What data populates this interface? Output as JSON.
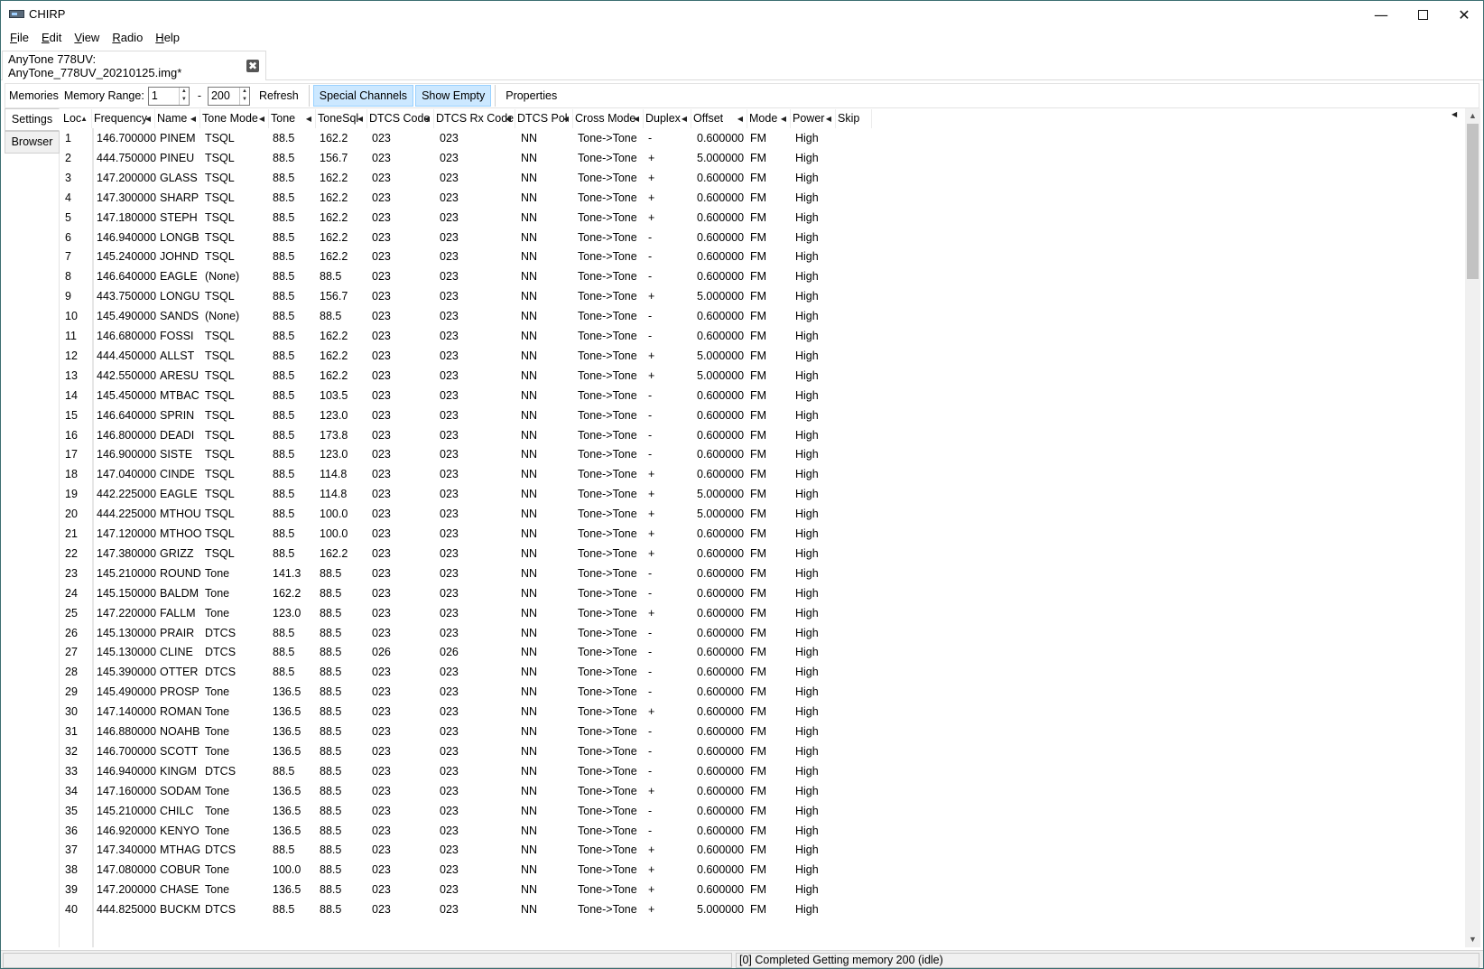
{
  "window": {
    "title": "CHIRP",
    "min_glyph": "—",
    "close_glyph": "✕"
  },
  "menu": [
    {
      "label": "File",
      "key": "F",
      "rest": "ile"
    },
    {
      "label": "Edit",
      "key": "E",
      "rest": "dit"
    },
    {
      "label": "View",
      "key": "V",
      "rest": "iew"
    },
    {
      "label": "Radio",
      "key": "R",
      "rest": "adio"
    },
    {
      "label": "Help",
      "key": "H",
      "rest": "elp"
    }
  ],
  "file_tab": {
    "label": "AnyTone 778UV: AnyTone_778UV_20210125.img*",
    "close_glyph": "✖"
  },
  "toolbar": {
    "memories_label": "Memories",
    "range_label": "Memory Range:",
    "range_start": "1",
    "range_dash": "-",
    "range_end": "200",
    "refresh": "Refresh",
    "special_channels": "Special Channels",
    "show_empty": "Show Empty",
    "properties": "Properties"
  },
  "sidebar": {
    "settings": "Settings",
    "browser": "Browser"
  },
  "columns": [
    "Loc",
    "Frequency",
    "Name",
    "Tone Mode",
    "Tone",
    "ToneSql",
    "DTCS Code",
    "DTCS Rx Code",
    "DTCS Pol",
    "Cross Mode",
    "Duplex",
    "Offset",
    "Mode",
    "Power",
    "Skip"
  ],
  "rows": [
    [
      "1",
      "146.700000",
      "PINEM",
      "TSQL",
      "88.5",
      "162.2",
      "023",
      "023",
      "NN",
      "Tone->Tone",
      "-",
      "0.600000",
      "FM",
      "High",
      ""
    ],
    [
      "2",
      "444.750000",
      "PINEU",
      "TSQL",
      "88.5",
      "156.7",
      "023",
      "023",
      "NN",
      "Tone->Tone",
      "+",
      "5.000000",
      "FM",
      "High",
      ""
    ],
    [
      "3",
      "147.200000",
      "GLASS",
      "TSQL",
      "88.5",
      "162.2",
      "023",
      "023",
      "NN",
      "Tone->Tone",
      "+",
      "0.600000",
      "FM",
      "High",
      ""
    ],
    [
      "4",
      "147.300000",
      "SHARP",
      "TSQL",
      "88.5",
      "162.2",
      "023",
      "023",
      "NN",
      "Tone->Tone",
      "+",
      "0.600000",
      "FM",
      "High",
      ""
    ],
    [
      "5",
      "147.180000",
      "STEPH",
      "TSQL",
      "88.5",
      "162.2",
      "023",
      "023",
      "NN",
      "Tone->Tone",
      "+",
      "0.600000",
      "FM",
      "High",
      ""
    ],
    [
      "6",
      "146.940000",
      "LONGB",
      "TSQL",
      "88.5",
      "162.2",
      "023",
      "023",
      "NN",
      "Tone->Tone",
      "-",
      "0.600000",
      "FM",
      "High",
      ""
    ],
    [
      "7",
      "145.240000",
      "JOHND",
      "TSQL",
      "88.5",
      "162.2",
      "023",
      "023",
      "NN",
      "Tone->Tone",
      "-",
      "0.600000",
      "FM",
      "High",
      ""
    ],
    [
      "8",
      "146.640000",
      "EAGLE",
      "(None)",
      "88.5",
      "88.5",
      "023",
      "023",
      "NN",
      "Tone->Tone",
      "-",
      "0.600000",
      "FM",
      "High",
      ""
    ],
    [
      "9",
      "443.750000",
      "LONGU",
      "TSQL",
      "88.5",
      "156.7",
      "023",
      "023",
      "NN",
      "Tone->Tone",
      "+",
      "5.000000",
      "FM",
      "High",
      ""
    ],
    [
      "10",
      "145.490000",
      "SANDS",
      "(None)",
      "88.5",
      "88.5",
      "023",
      "023",
      "NN",
      "Tone->Tone",
      "-",
      "0.600000",
      "FM",
      "High",
      ""
    ],
    [
      "11",
      "146.680000",
      "FOSSI",
      "TSQL",
      "88.5",
      "162.2",
      "023",
      "023",
      "NN",
      "Tone->Tone",
      "-",
      "0.600000",
      "FM",
      "High",
      ""
    ],
    [
      "12",
      "444.450000",
      "ALLST",
      "TSQL",
      "88.5",
      "162.2",
      "023",
      "023",
      "NN",
      "Tone->Tone",
      "+",
      "5.000000",
      "FM",
      "High",
      ""
    ],
    [
      "13",
      "442.550000",
      "ARESU",
      "TSQL",
      "88.5",
      "162.2",
      "023",
      "023",
      "NN",
      "Tone->Tone",
      "+",
      "5.000000",
      "FM",
      "High",
      ""
    ],
    [
      "14",
      "145.450000",
      "MTBAC",
      "TSQL",
      "88.5",
      "103.5",
      "023",
      "023",
      "NN",
      "Tone->Tone",
      "-",
      "0.600000",
      "FM",
      "High",
      ""
    ],
    [
      "15",
      "146.640000",
      "SPRIN",
      "TSQL",
      "88.5",
      "123.0",
      "023",
      "023",
      "NN",
      "Tone->Tone",
      "-",
      "0.600000",
      "FM",
      "High",
      ""
    ],
    [
      "16",
      "146.800000",
      "DEADI",
      "TSQL",
      "88.5",
      "173.8",
      "023",
      "023",
      "NN",
      "Tone->Tone",
      "-",
      "0.600000",
      "FM",
      "High",
      ""
    ],
    [
      "17",
      "146.900000",
      "SISTE",
      "TSQL",
      "88.5",
      "123.0",
      "023",
      "023",
      "NN",
      "Tone->Tone",
      "-",
      "0.600000",
      "FM",
      "High",
      ""
    ],
    [
      "18",
      "147.040000",
      "CINDE",
      "TSQL",
      "88.5",
      "114.8",
      "023",
      "023",
      "NN",
      "Tone->Tone",
      "+",
      "0.600000",
      "FM",
      "High",
      ""
    ],
    [
      "19",
      "442.225000",
      "EAGLE",
      "TSQL",
      "88.5",
      "114.8",
      "023",
      "023",
      "NN",
      "Tone->Tone",
      "+",
      "5.000000",
      "FM",
      "High",
      ""
    ],
    [
      "20",
      "444.225000",
      "MTHOU",
      "TSQL",
      "88.5",
      "100.0",
      "023",
      "023",
      "NN",
      "Tone->Tone",
      "+",
      "5.000000",
      "FM",
      "High",
      ""
    ],
    [
      "21",
      "147.120000",
      "MTHOO",
      "TSQL",
      "88.5",
      "100.0",
      "023",
      "023",
      "NN",
      "Tone->Tone",
      "+",
      "0.600000",
      "FM",
      "High",
      ""
    ],
    [
      "22",
      "147.380000",
      "GRIZZ",
      "TSQL",
      "88.5",
      "162.2",
      "023",
      "023",
      "NN",
      "Tone->Tone",
      "+",
      "0.600000",
      "FM",
      "High",
      ""
    ],
    [
      "23",
      "145.210000",
      "ROUND",
      "Tone",
      "141.3",
      "88.5",
      "023",
      "023",
      "NN",
      "Tone->Tone",
      "-",
      "0.600000",
      "FM",
      "High",
      ""
    ],
    [
      "24",
      "145.150000",
      "BALDM",
      "Tone",
      "162.2",
      "88.5",
      "023",
      "023",
      "NN",
      "Tone->Tone",
      "-",
      "0.600000",
      "FM",
      "High",
      ""
    ],
    [
      "25",
      "147.220000",
      "FALLM",
      "Tone",
      "123.0",
      "88.5",
      "023",
      "023",
      "NN",
      "Tone->Tone",
      "+",
      "0.600000",
      "FM",
      "High",
      ""
    ],
    [
      "26",
      "145.130000",
      "PRAIR",
      "DTCS",
      "88.5",
      "88.5",
      "023",
      "023",
      "NN",
      "Tone->Tone",
      "-",
      "0.600000",
      "FM",
      "High",
      ""
    ],
    [
      "27",
      "145.130000",
      "CLINE",
      "DTCS",
      "88.5",
      "88.5",
      "026",
      "026",
      "NN",
      "Tone->Tone",
      "-",
      "0.600000",
      "FM",
      "High",
      ""
    ],
    [
      "28",
      "145.390000",
      "OTTER",
      "DTCS",
      "88.5",
      "88.5",
      "023",
      "023",
      "NN",
      "Tone->Tone",
      "-",
      "0.600000",
      "FM",
      "High",
      ""
    ],
    [
      "29",
      "145.490000",
      "PROSP",
      "Tone",
      "136.5",
      "88.5",
      "023",
      "023",
      "NN",
      "Tone->Tone",
      "-",
      "0.600000",
      "FM",
      "High",
      ""
    ],
    [
      "30",
      "147.140000",
      "ROMAN",
      "Tone",
      "136.5",
      "88.5",
      "023",
      "023",
      "NN",
      "Tone->Tone",
      "+",
      "0.600000",
      "FM",
      "High",
      ""
    ],
    [
      "31",
      "146.880000",
      "NOAHB",
      "Tone",
      "136.5",
      "88.5",
      "023",
      "023",
      "NN",
      "Tone->Tone",
      "-",
      "0.600000",
      "FM",
      "High",
      ""
    ],
    [
      "32",
      "146.700000",
      "SCOTT",
      "Tone",
      "136.5",
      "88.5",
      "023",
      "023",
      "NN",
      "Tone->Tone",
      "-",
      "0.600000",
      "FM",
      "High",
      ""
    ],
    [
      "33",
      "146.940000",
      "KINGM",
      "DTCS",
      "88.5",
      "88.5",
      "023",
      "023",
      "NN",
      "Tone->Tone",
      "-",
      "0.600000",
      "FM",
      "High",
      ""
    ],
    [
      "34",
      "147.160000",
      "SODAM",
      "Tone",
      "136.5",
      "88.5",
      "023",
      "023",
      "NN",
      "Tone->Tone",
      "+",
      "0.600000",
      "FM",
      "High",
      ""
    ],
    [
      "35",
      "145.210000",
      "CHILC",
      "Tone",
      "136.5",
      "88.5",
      "023",
      "023",
      "NN",
      "Tone->Tone",
      "-",
      "0.600000",
      "FM",
      "High",
      ""
    ],
    [
      "36",
      "146.920000",
      "KENYO",
      "Tone",
      "136.5",
      "88.5",
      "023",
      "023",
      "NN",
      "Tone->Tone",
      "-",
      "0.600000",
      "FM",
      "High",
      ""
    ],
    [
      "37",
      "147.340000",
      "MTHAG",
      "DTCS",
      "88.5",
      "88.5",
      "023",
      "023",
      "NN",
      "Tone->Tone",
      "+",
      "0.600000",
      "FM",
      "High",
      ""
    ],
    [
      "38",
      "147.080000",
      "COBUR",
      "Tone",
      "100.0",
      "88.5",
      "023",
      "023",
      "NN",
      "Tone->Tone",
      "+",
      "0.600000",
      "FM",
      "High",
      ""
    ],
    [
      "39",
      "147.200000",
      "CHASE",
      "Tone",
      "136.5",
      "88.5",
      "023",
      "023",
      "NN",
      "Tone->Tone",
      "+",
      "0.600000",
      "FM",
      "High",
      ""
    ],
    [
      "40",
      "444.825000",
      "BUCKM",
      "DTCS",
      "88.5",
      "88.5",
      "023",
      "023",
      "NN",
      "Tone->Tone",
      "+",
      "5.000000",
      "FM",
      "High",
      ""
    ]
  ],
  "status": {
    "message": "[0] Completed Getting memory 200 (idle)"
  },
  "icons": {
    "app": "radio-icon",
    "sort_asc": "▲",
    "sort_left": "◀",
    "spin_up": "▲",
    "spin_down": "▼",
    "scroll_up": "▲",
    "scroll_down": "▼"
  },
  "colors": {
    "toggle_bg": "#cce8ff",
    "toggle_border": "#99d1ff",
    "window_border": "#3c6e71"
  }
}
